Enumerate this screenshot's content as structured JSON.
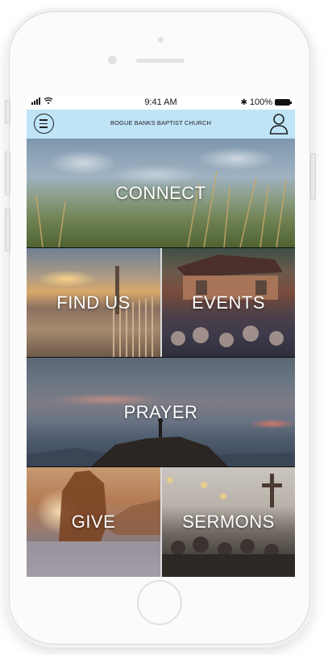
{
  "status_bar": {
    "time": "9:41 AM",
    "battery": "100%",
    "bluetooth_glyph": "✱"
  },
  "header": {
    "title": "BOGUE BANKS BAPTIST CHURCH",
    "menu_icon": "hamburger-circle-icon",
    "profile_icon": "user-icon",
    "background": "#bfe4f6"
  },
  "tiles": [
    {
      "key": "connect",
      "label": "CONNECT"
    },
    {
      "key": "find_us",
      "label": "FIND US"
    },
    {
      "key": "events",
      "label": "EVENTS"
    },
    {
      "key": "prayer",
      "label": "PRAYER"
    },
    {
      "key": "give",
      "label": "GIVE"
    },
    {
      "key": "sermons",
      "label": "SERMONS"
    }
  ]
}
